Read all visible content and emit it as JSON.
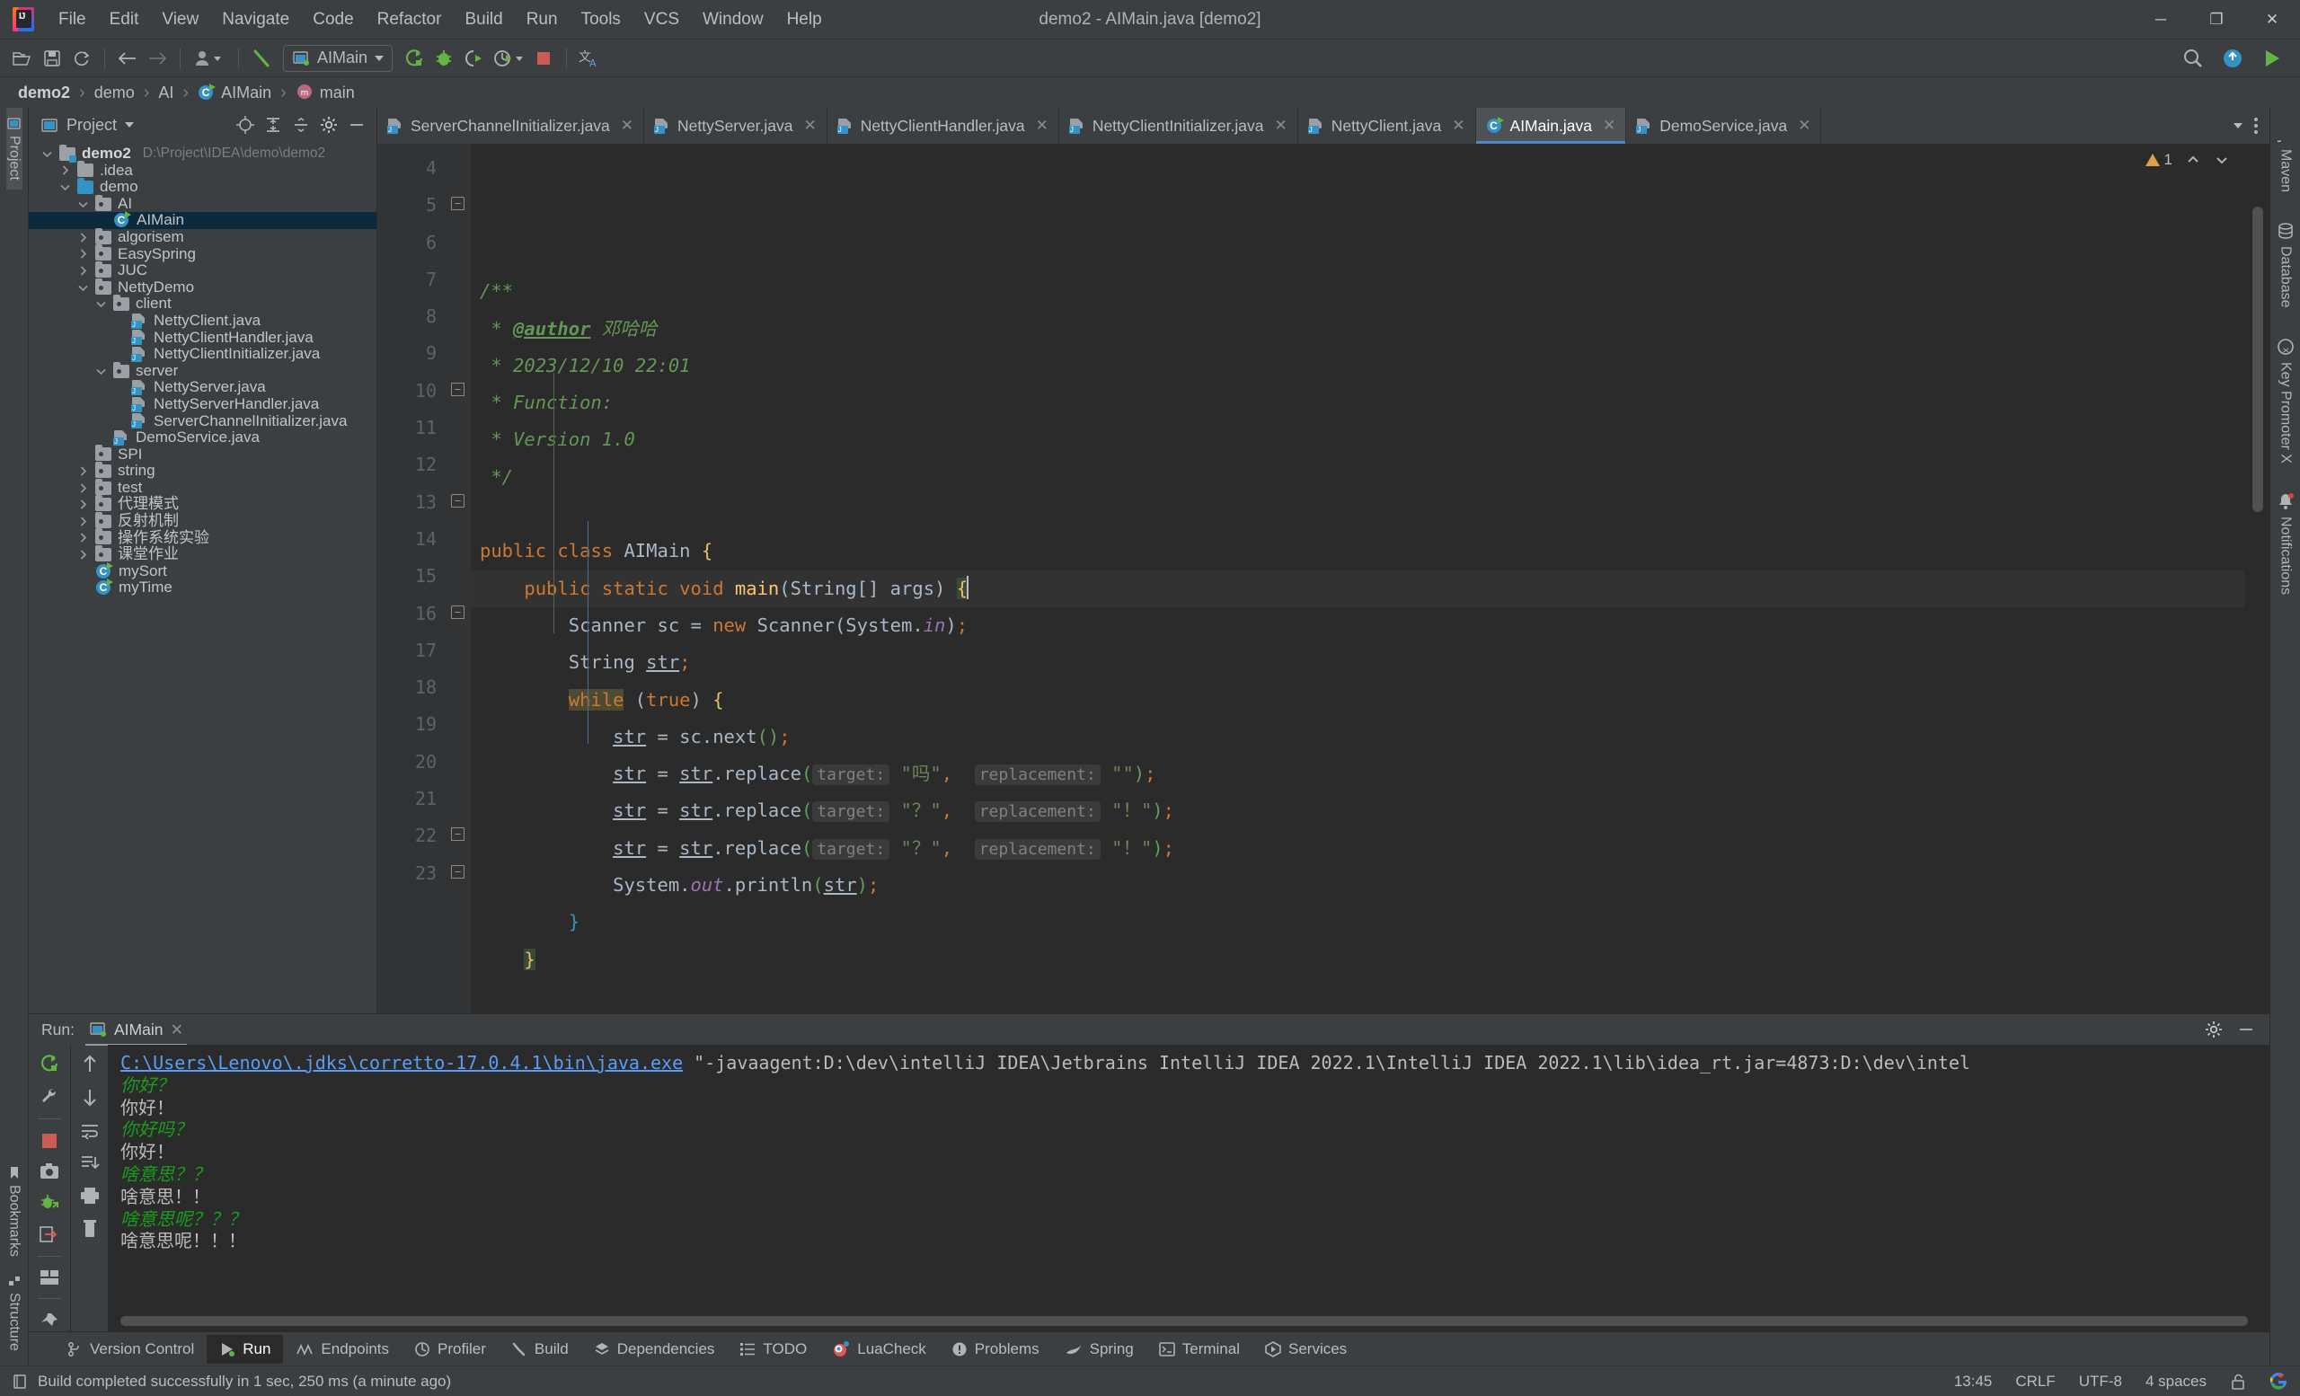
{
  "window": {
    "title": "demo2 - AIMain.java [demo2]",
    "minimize_label": "─",
    "maximize_label": "❐",
    "close_label": "✕"
  },
  "menubar": {
    "items": [
      "File",
      "Edit",
      "View",
      "Navigate",
      "Code",
      "Refactor",
      "Build",
      "Run",
      "Tools",
      "VCS",
      "Window",
      "Help"
    ]
  },
  "toolbar": {
    "icons": [
      "open-folder-icon",
      "save-all-icon",
      "sync-icon",
      "back-arrow-icon",
      "forward-arrow-icon",
      "profile-dropdown-icon",
      "build-hammer-icon"
    ],
    "run_config_label": "AIMain",
    "run_icon": "run-icon",
    "debug_icon": "debug-icon",
    "run_with_coverage_icon": "run-coverage-icon",
    "profile_icon": "profile-run-icon",
    "stop_icon": "stop-icon",
    "translate_icon": "translate-icon",
    "search_icon": "search-everywhere-icon",
    "updates_icon": "updates-icon",
    "run_green_icon": "run-green-icon"
  },
  "breadcrumb": {
    "items": [
      {
        "label": "demo2",
        "icon": ""
      },
      {
        "label": "demo",
        "icon": ""
      },
      {
        "label": "AI",
        "icon": ""
      },
      {
        "label": "AIMain",
        "icon": "class-icon"
      },
      {
        "label": "main",
        "icon": "method-icon"
      }
    ],
    "separator": "›"
  },
  "left_strip": {
    "project_tab": "Project",
    "bookmarks_tab": "Bookmarks",
    "structure_tab": "Structure"
  },
  "right_strip": {
    "items": [
      {
        "label": "Maven",
        "icon": "maven-icon"
      },
      {
        "label": "Database",
        "icon": "database-icon"
      },
      {
        "label": "Key Promoter X",
        "icon": "key-promoter-icon"
      },
      {
        "label": "Notifications",
        "icon": "notifications-icon"
      }
    ]
  },
  "project_panel": {
    "title": "Project",
    "actions": [
      "locate-icon",
      "expand-all-icon",
      "collapse-all-icon",
      "settings-gear-icon",
      "hide-icon"
    ],
    "tree": [
      {
        "depth": 0,
        "twist": "down",
        "icon": "module-folder",
        "label": "demo2",
        "bold": true,
        "path": "D:\\Project\\IDEA\\demo\\demo2",
        "selected": false
      },
      {
        "depth": 1,
        "twist": "right",
        "icon": "folder-gray",
        "label": ".idea",
        "selected": false
      },
      {
        "depth": 1,
        "twist": "down",
        "icon": "folder-blue",
        "label": "demo",
        "selected": false
      },
      {
        "depth": 2,
        "twist": "down",
        "icon": "folder-src",
        "label": "AI",
        "selected": false
      },
      {
        "depth": 3,
        "twist": "none",
        "icon": "class-run",
        "label": "AIMain",
        "selected": true
      },
      {
        "depth": 2,
        "twist": "right",
        "icon": "folder-src",
        "label": "algorisem",
        "selected": false
      },
      {
        "depth": 2,
        "twist": "right",
        "icon": "folder-src",
        "label": "EasySpring",
        "selected": false
      },
      {
        "depth": 2,
        "twist": "right",
        "icon": "folder-src",
        "label": "JUC",
        "selected": false
      },
      {
        "depth": 2,
        "twist": "down",
        "icon": "folder-src",
        "label": "NettyDemo",
        "selected": false
      },
      {
        "depth": 3,
        "twist": "down",
        "icon": "folder-src",
        "label": "client",
        "selected": false
      },
      {
        "depth": 4,
        "twist": "none",
        "icon": "java-file",
        "label": "NettyClient.java",
        "selected": false
      },
      {
        "depth": 4,
        "twist": "none",
        "icon": "java-file",
        "label": "NettyClientHandler.java",
        "selected": false
      },
      {
        "depth": 4,
        "twist": "none",
        "icon": "java-file",
        "label": "NettyClientInitializer.java",
        "selected": false
      },
      {
        "depth": 3,
        "twist": "down",
        "icon": "folder-src",
        "label": "server",
        "selected": false
      },
      {
        "depth": 4,
        "twist": "none",
        "icon": "java-file",
        "label": "NettyServer.java",
        "selected": false
      },
      {
        "depth": 4,
        "twist": "none",
        "icon": "java-file",
        "label": "NettyServerHandler.java",
        "selected": false
      },
      {
        "depth": 4,
        "twist": "none",
        "icon": "java-file",
        "label": "ServerChannelInitializer.java",
        "selected": false
      },
      {
        "depth": 3,
        "twist": "none",
        "icon": "java-file",
        "label": "DemoService.java",
        "selected": false
      },
      {
        "depth": 2,
        "twist": "none",
        "icon": "folder-src",
        "label": "SPI",
        "selected": false
      },
      {
        "depth": 2,
        "twist": "right",
        "icon": "folder-src",
        "label": "string",
        "selected": false
      },
      {
        "depth": 2,
        "twist": "right",
        "icon": "folder-src",
        "label": "test",
        "selected": false
      },
      {
        "depth": 2,
        "twist": "right",
        "icon": "folder-src",
        "label": "代理模式",
        "selected": false
      },
      {
        "depth": 2,
        "twist": "right",
        "icon": "folder-src",
        "label": "反射机制",
        "selected": false
      },
      {
        "depth": 2,
        "twist": "right",
        "icon": "folder-src",
        "label": "操作系统实验",
        "selected": false
      },
      {
        "depth": 2,
        "twist": "right",
        "icon": "folder-src",
        "label": "课堂作业",
        "selected": false
      },
      {
        "depth": 2,
        "twist": "none",
        "icon": "class-run",
        "label": "mySort",
        "selected": false
      },
      {
        "depth": 2,
        "twist": "none",
        "icon": "class-run",
        "label": "myTime",
        "selected": false
      }
    ]
  },
  "editor": {
    "tabs": [
      {
        "label": "ServerChannelInitializer.java",
        "icon": "java-file",
        "active": false
      },
      {
        "label": "NettyServer.java",
        "icon": "java-file",
        "active": false
      },
      {
        "label": "NettyClientHandler.java",
        "icon": "java-file",
        "active": false
      },
      {
        "label": "NettyClientInitializer.java",
        "icon": "java-file",
        "active": false
      },
      {
        "label": "NettyClient.java",
        "icon": "java-file",
        "active": false
      },
      {
        "label": "AIMain.java",
        "icon": "class-run",
        "active": true
      },
      {
        "label": "DemoService.java",
        "icon": "java-file",
        "active": false
      }
    ],
    "tab_close_glyph": "✕",
    "tabs_overflow_icon": "chevron-down-icon",
    "tabs_menu_icon": "more-options-icon",
    "inspection": {
      "warning_count": "1",
      "up_icon": "prev-problem-icon",
      "down_icon": "next-problem-icon"
    },
    "first_line_number": 4,
    "lines": [
      {
        "n": 4,
        "text": "",
        "fold": "",
        "run": false,
        "current": false
      },
      {
        "n": 5,
        "text": "/**",
        "fold": "open",
        "run": false,
        "current": false
      },
      {
        "n": 6,
        "text": " * @author 邓哈哈",
        "fold": "",
        "run": false,
        "current": false
      },
      {
        "n": 7,
        "text": " * 2023/12/10 22:01",
        "fold": "",
        "run": false,
        "current": false
      },
      {
        "n": 8,
        "text": " * Function:",
        "fold": "",
        "run": false,
        "current": false
      },
      {
        "n": 9,
        "text": " * Version 1.0",
        "fold": "",
        "run": false,
        "current": false
      },
      {
        "n": 10,
        "text": " */",
        "fold": "close",
        "run": false,
        "current": false
      },
      {
        "n": 11,
        "text": "",
        "fold": "",
        "run": false,
        "current": false
      },
      {
        "n": 12,
        "text": "public class AIMain {",
        "fold": "",
        "run": true,
        "current": false
      },
      {
        "n": 13,
        "text": "    public static void main(String[] args) {",
        "fold": "open",
        "run": true,
        "current": true
      },
      {
        "n": 14,
        "text": "        Scanner sc = new Scanner(System.in);",
        "fold": "",
        "run": false,
        "current": false
      },
      {
        "n": 15,
        "text": "        String str;",
        "fold": "",
        "run": false,
        "current": false
      },
      {
        "n": 16,
        "text": "        while (true) {",
        "fold": "open",
        "run": false,
        "current": false
      },
      {
        "n": 17,
        "text": "            str = sc.next();",
        "fold": "",
        "run": false,
        "current": false
      },
      {
        "n": 18,
        "text": "            str = str.replace( target: \"吗\",  replacement: \"\");",
        "fold": "",
        "run": false,
        "current": false
      },
      {
        "n": 19,
        "text": "            str = str.replace( target: \"？\",  replacement: \"！\");",
        "fold": "",
        "run": false,
        "current": false
      },
      {
        "n": 20,
        "text": "            str = str.replace( target: \"？\",  replacement: \"！\");",
        "fold": "",
        "run": false,
        "current": false
      },
      {
        "n": 21,
        "text": "            System.out.println(str);",
        "fold": "",
        "run": false,
        "current": false
      },
      {
        "n": 22,
        "text": "        }",
        "fold": "close",
        "run": false,
        "current": false
      },
      {
        "n": 23,
        "text": "    }",
        "fold": "close",
        "run": false,
        "current": false
      }
    ],
    "code_parts": {
      "l18_hint_target": "target:",
      "l18_hint_replacement": "replacement:",
      "l18_str_target": "\"吗\"",
      "l18_str_replacement": "\"\"",
      "l19_str_target": "\"？\"",
      "l19_str_replacement": "\"！\"",
      "l20_str_target": "\"？\"",
      "l20_str_replacement": "\"！\""
    }
  },
  "run_panel": {
    "label": "Run:",
    "tab_label": "AIMain",
    "tab_icon": "run-config-icon",
    "tab_close": "✕",
    "settings_icon": "settings-gear-icon",
    "hide_icon": "hide-icon",
    "side_icons": [
      "rerun-icon",
      "wrench-icon",
      "stop-icon",
      "camera-icon",
      "debug-attach-icon",
      "export-icon",
      "layout-icon",
      "pin-icon"
    ],
    "side2_icons": [
      "scroll-up-icon",
      "scroll-down-icon",
      "soft-wrap-icon",
      "scroll-to-end-icon",
      "print-icon",
      "clear-all-icon"
    ],
    "console": [
      {
        "type": "link",
        "text": "C:\\Users\\Lenovo\\.jdks\\corretto-17.0.4.1\\bin\\java.exe",
        "suffix": " \"-javaagent:D:\\dev\\intelliJ IDEA\\Jetbrains IntelliJ IDEA 2022.1\\IntelliJ IDEA 2022.1\\lib\\idea_rt.jar=4873:D:\\dev\\intel"
      },
      {
        "type": "input",
        "text": "你好？"
      },
      {
        "type": "output",
        "text": "你好！"
      },
      {
        "type": "input",
        "text": "你好吗？"
      },
      {
        "type": "output",
        "text": "你好！"
      },
      {
        "type": "input",
        "text": "啥意思？？"
      },
      {
        "type": "output",
        "text": "啥意思！！"
      },
      {
        "type": "input",
        "text": "啥意思呢？？？"
      },
      {
        "type": "output",
        "text": "啥意思呢！！！"
      }
    ]
  },
  "toolwindow_bar": {
    "items": [
      {
        "label": "Version Control",
        "icon": "branch-icon",
        "active": false
      },
      {
        "label": "Run",
        "icon": "run-icon",
        "active": true
      },
      {
        "label": "Endpoints",
        "icon": "endpoints-icon",
        "active": false
      },
      {
        "label": "Profiler",
        "icon": "profiler-icon",
        "active": false
      },
      {
        "label": "Build",
        "icon": "hammer-icon",
        "active": false
      },
      {
        "label": "Dependencies",
        "icon": "dependencies-icon",
        "active": false
      },
      {
        "label": "TODO",
        "icon": "todo-icon",
        "active": false
      },
      {
        "label": "LuaCheck",
        "icon": "luacheck-icon",
        "active": false
      },
      {
        "label": "Problems",
        "icon": "problems-icon",
        "active": false
      },
      {
        "label": "Spring",
        "icon": "spring-icon",
        "active": false
      },
      {
        "label": "Terminal",
        "icon": "terminal-icon",
        "active": false
      },
      {
        "label": "Services",
        "icon": "services-icon",
        "active": false
      }
    ]
  },
  "statusbar": {
    "message": "Build completed successfully in 1 sec, 250 ms (a minute ago)",
    "message_icon": "build-status-icon",
    "time": "13:45",
    "line_separator": "CRLF",
    "encoding": "UTF-8",
    "indent": "4 spaces",
    "lock_icon": "unlocked-icon",
    "google_icon": "google-icon"
  },
  "colors": {
    "accent_blue": "#4a88c7",
    "selection_blue": "#0d293e",
    "panel_bg": "#3c3f41",
    "editor_bg": "#2b2b2b",
    "green_run": "#62b543",
    "warning_amber": "#d9a343",
    "console_input_green": "#1a9e1a",
    "link_blue": "#589df6"
  }
}
